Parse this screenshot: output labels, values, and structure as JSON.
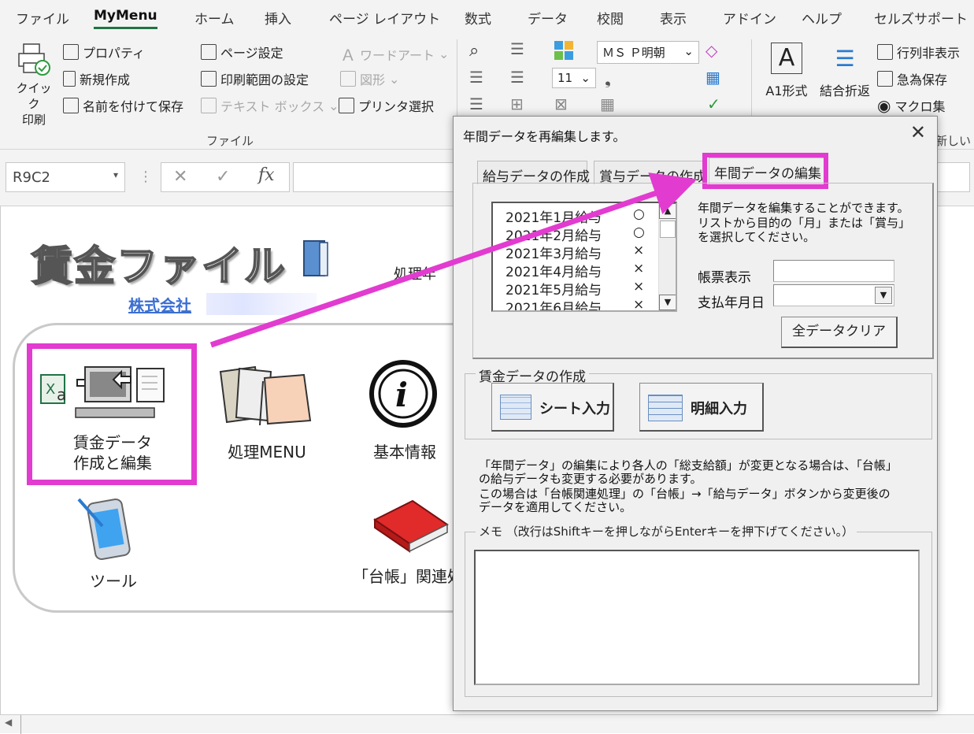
{
  "ribbon_tabs": [
    "ファイル",
    "MyMenu",
    "ホーム",
    "挿入",
    "ページ レイアウト",
    "数式",
    "データ",
    "校閲",
    "表示",
    "アドイン",
    "ヘルプ",
    "セルズサポート"
  ],
  "ribbon": {
    "quick_print_line1": "クイック",
    "quick_print_line2": "印刷",
    "properties": "プロパティ",
    "new_create": "新規作成",
    "save_as": "名前を付けて保存",
    "page_setup": "ページ設定",
    "print_area": "印刷範囲の設定",
    "printer_select": "プリンタ選択",
    "wordart": "ワードアート",
    "shape": "図形",
    "textbox": "テキスト ボックス",
    "group_file": "ファイル",
    "font_name": "ＭＳ Ｐ明朝",
    "font_size": "11",
    "a1_format": "A1形式",
    "wrap_merge": "結合折返",
    "hide_rowcol": "行列非表示",
    "quick_save": "急為保存",
    "macro_collection": "マクロ集",
    "cutoff_label": "新しいグ"
  },
  "formula_bar": {
    "name_box": "R9C2",
    "cancel": "✕",
    "enter": "✓",
    "fx": "fx"
  },
  "sheet": {
    "title": "賃金ファイル",
    "company": "株式会社",
    "processing_year": "処理年",
    "items": {
      "wage_data_line1": "賃金データ",
      "wage_data_line2": "作成と編集",
      "processing_menu": "処理MENU",
      "basic_info": "基本情報",
      "tools": "ツール",
      "ledger": "「台帳」関連処"
    }
  },
  "dialog": {
    "title": "年間データを再編集します。",
    "close": "✕",
    "tabs": [
      "給与データの作成",
      "賞与データの作成",
      "年間データの編集"
    ],
    "list": [
      {
        "label": "2021年1月給与",
        "mark": "○"
      },
      {
        "label": "2021年2月給与",
        "mark": "○"
      },
      {
        "label": "2021年3月給与",
        "mark": "×"
      },
      {
        "label": "2021年4月給与",
        "mark": "×"
      },
      {
        "label": "2021年5月給与",
        "mark": "×"
      },
      {
        "label": "2021年6月給与",
        "mark": "×"
      }
    ],
    "desc_line1": "年間データを編集することができます。",
    "desc_line2": "リストから目的の「月」または「賞与」",
    "desc_line3": "を選択してください。",
    "report_display_label": "帳票表示",
    "payment_date_label": "支払年月日",
    "clear_all": "全データクリア",
    "wage_group_label": "賃金データの作成",
    "sheet_input": "シート入力",
    "detail_input": "明細入力",
    "note_line1": "「年間データ」の編集により各人の「総支給額」が変更となる場合は、「台帳」",
    "note_line2": "の給与データも変更する必要があります。",
    "note_line3": "この場合は「台帳関連処理」の「台帳」→「給与データ」ボタンから変更後の",
    "note_line4": "データを適用してください。",
    "memo_label": "メモ （改行はShiftキーを押しながらEnterキーを押下げてください。）"
  },
  "colors": {
    "highlight": "#e23bd0",
    "excel_green": "#217346"
  }
}
